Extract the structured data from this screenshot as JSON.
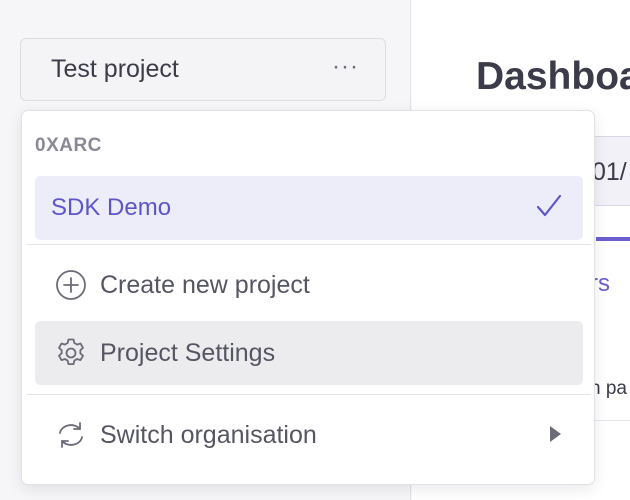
{
  "sidebar": {
    "project_button": {
      "label": "Test project",
      "menu_icon": "more-horizontal-icon"
    }
  },
  "main": {
    "title": "Dashboa",
    "date_fragment": "01/",
    "tab_fragment": "rs",
    "text_fragment": "n pa"
  },
  "dropdown": {
    "org_heading": "0XARC",
    "projects": [
      {
        "label": "SDK Demo",
        "selected": true,
        "icon": "checkmark-icon"
      }
    ],
    "actions": [
      {
        "label": "Create new project",
        "icon": "plus-circle-icon"
      },
      {
        "label": "Project Settings",
        "icon": "gear-icon",
        "highlighted": true
      }
    ],
    "switch_org": {
      "label": "Switch organisation",
      "icon": "sync-icon",
      "chevron": "chevron-right-icon"
    }
  },
  "colors": {
    "accent": "#5f55c8",
    "selected_bg": "#ededfa",
    "hover_bg": "#ececef"
  }
}
